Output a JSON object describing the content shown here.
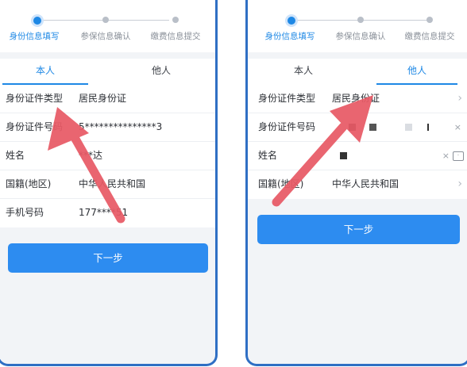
{
  "steps": [
    "身份信息填写",
    "参保信息确认",
    "缴费信息提交"
  ],
  "tabs": [
    "本人",
    "他人"
  ],
  "left": {
    "rows": [
      {
        "label": "身份证件类型",
        "value": "居民身份证"
      },
      {
        "label": "身份证件号码",
        "value": "5***************3"
      },
      {
        "label": "姓名",
        "value": "***达"
      },
      {
        "label": "国籍(地区)",
        "value": "中华人民共和国"
      },
      {
        "label": "手机号码",
        "value": "177****51"
      }
    ],
    "next_label": "下一步"
  },
  "right": {
    "rows": [
      {
        "label": "身份证件类型",
        "value": "居民身份证"
      },
      {
        "label": "身份证件号码",
        "value": ""
      },
      {
        "label": "姓名",
        "value": ""
      },
      {
        "label": "国籍(地区)",
        "value": "中华人民共和国"
      }
    ],
    "next_label": "下一步"
  },
  "icons": {
    "chevron": "›",
    "clear": "×"
  },
  "colors": {
    "accent": "#1e88e5",
    "button": "#2d8cf0",
    "frame": "#2f6fc4",
    "arrow": "#e85a66"
  }
}
